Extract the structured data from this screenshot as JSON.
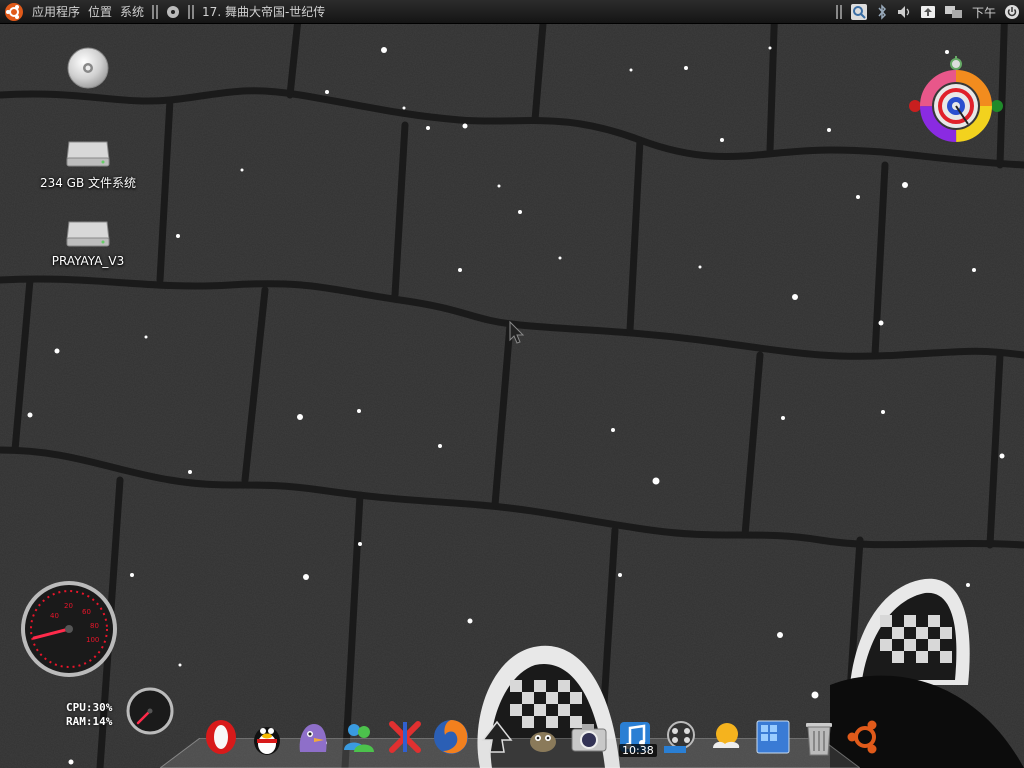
{
  "top_panel": {
    "app_menu_label": "应用程序",
    "places_label": "位置",
    "system_label": "系统",
    "music_track": "17. 舞曲大帝国-世纪传",
    "right_text": "下午"
  },
  "desktop_icons": [
    {
      "label": "",
      "icon": "cd-icon"
    },
    {
      "label": "234 GB 文件系统",
      "icon": "hard-drive-icon"
    },
    {
      "label": "PRAYAYA_V3",
      "icon": "usb-drive-icon"
    }
  ],
  "system_monitor": {
    "cpu_label": "CPU:30%",
    "ram_label": "RAM:14%",
    "cpu_percent": 30,
    "ram_percent": 14
  },
  "dock": {
    "clock": "10:38",
    "items": [
      "opera-icon",
      "qq-penguin-icon",
      "pidgin-icon",
      "messenger-icon",
      "xmind-icon",
      "firefox-icon",
      "inkscape-icon",
      "gimp-icon",
      "camera-icon",
      "music-player-icon",
      "video-player-icon",
      "weather-icon",
      "workspace-switcher-icon",
      "trash-icon",
      "ubuntu-icon"
    ]
  },
  "colors": {
    "panel_bg": "#1a1a1a",
    "gauge_red": "#e8152a",
    "ring_orange": "#f28c1e",
    "ring_yellow": "#f2d21e",
    "ring_purple": "#8a2be2",
    "ring_pink": "#e8578a",
    "ring_red": "#e0202a"
  }
}
